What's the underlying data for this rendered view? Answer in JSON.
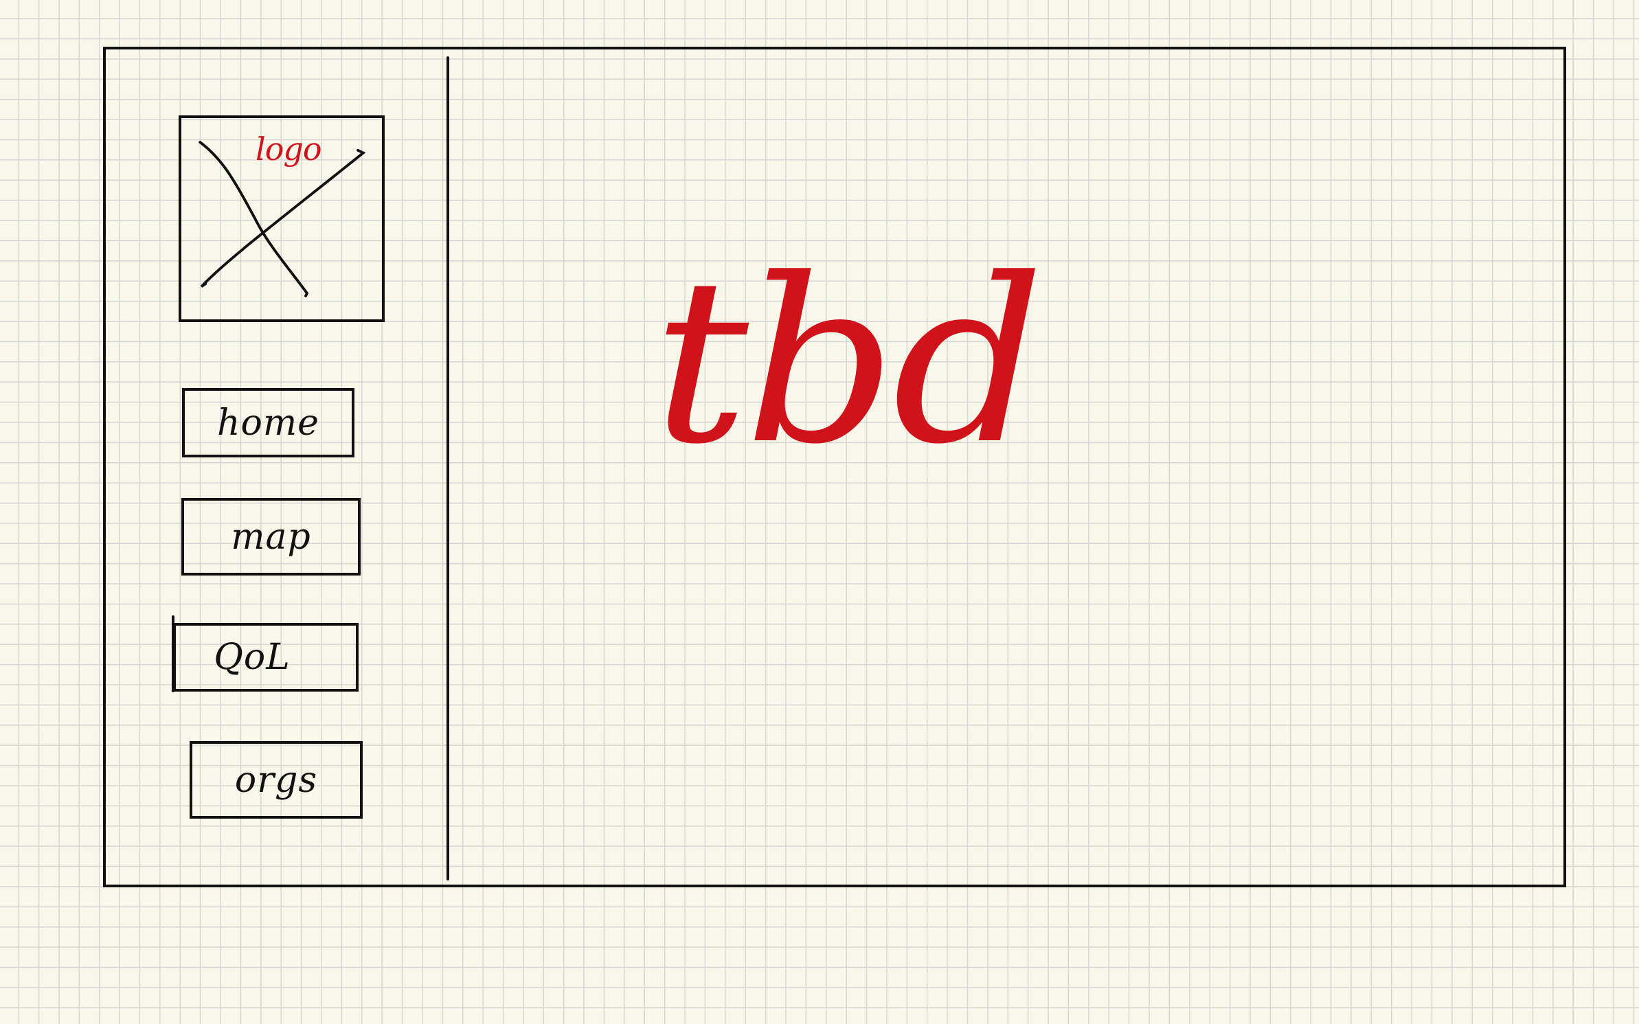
{
  "sidebar": {
    "logo": {
      "label": "logo",
      "icon": "placeholder-x-icon",
      "label_color": "#d0121b"
    },
    "nav_items": [
      {
        "label": "home"
      },
      {
        "label": "map"
      },
      {
        "label": "QoL"
      },
      {
        "label": "orgs"
      }
    ]
  },
  "main": {
    "placeholder_text": "tbd",
    "placeholder_color": "#d0121b"
  },
  "colors": {
    "ink": "#111111",
    "accent": "#d0121b",
    "paper": "#f8f7e9",
    "grid": "#d4d7d5"
  }
}
